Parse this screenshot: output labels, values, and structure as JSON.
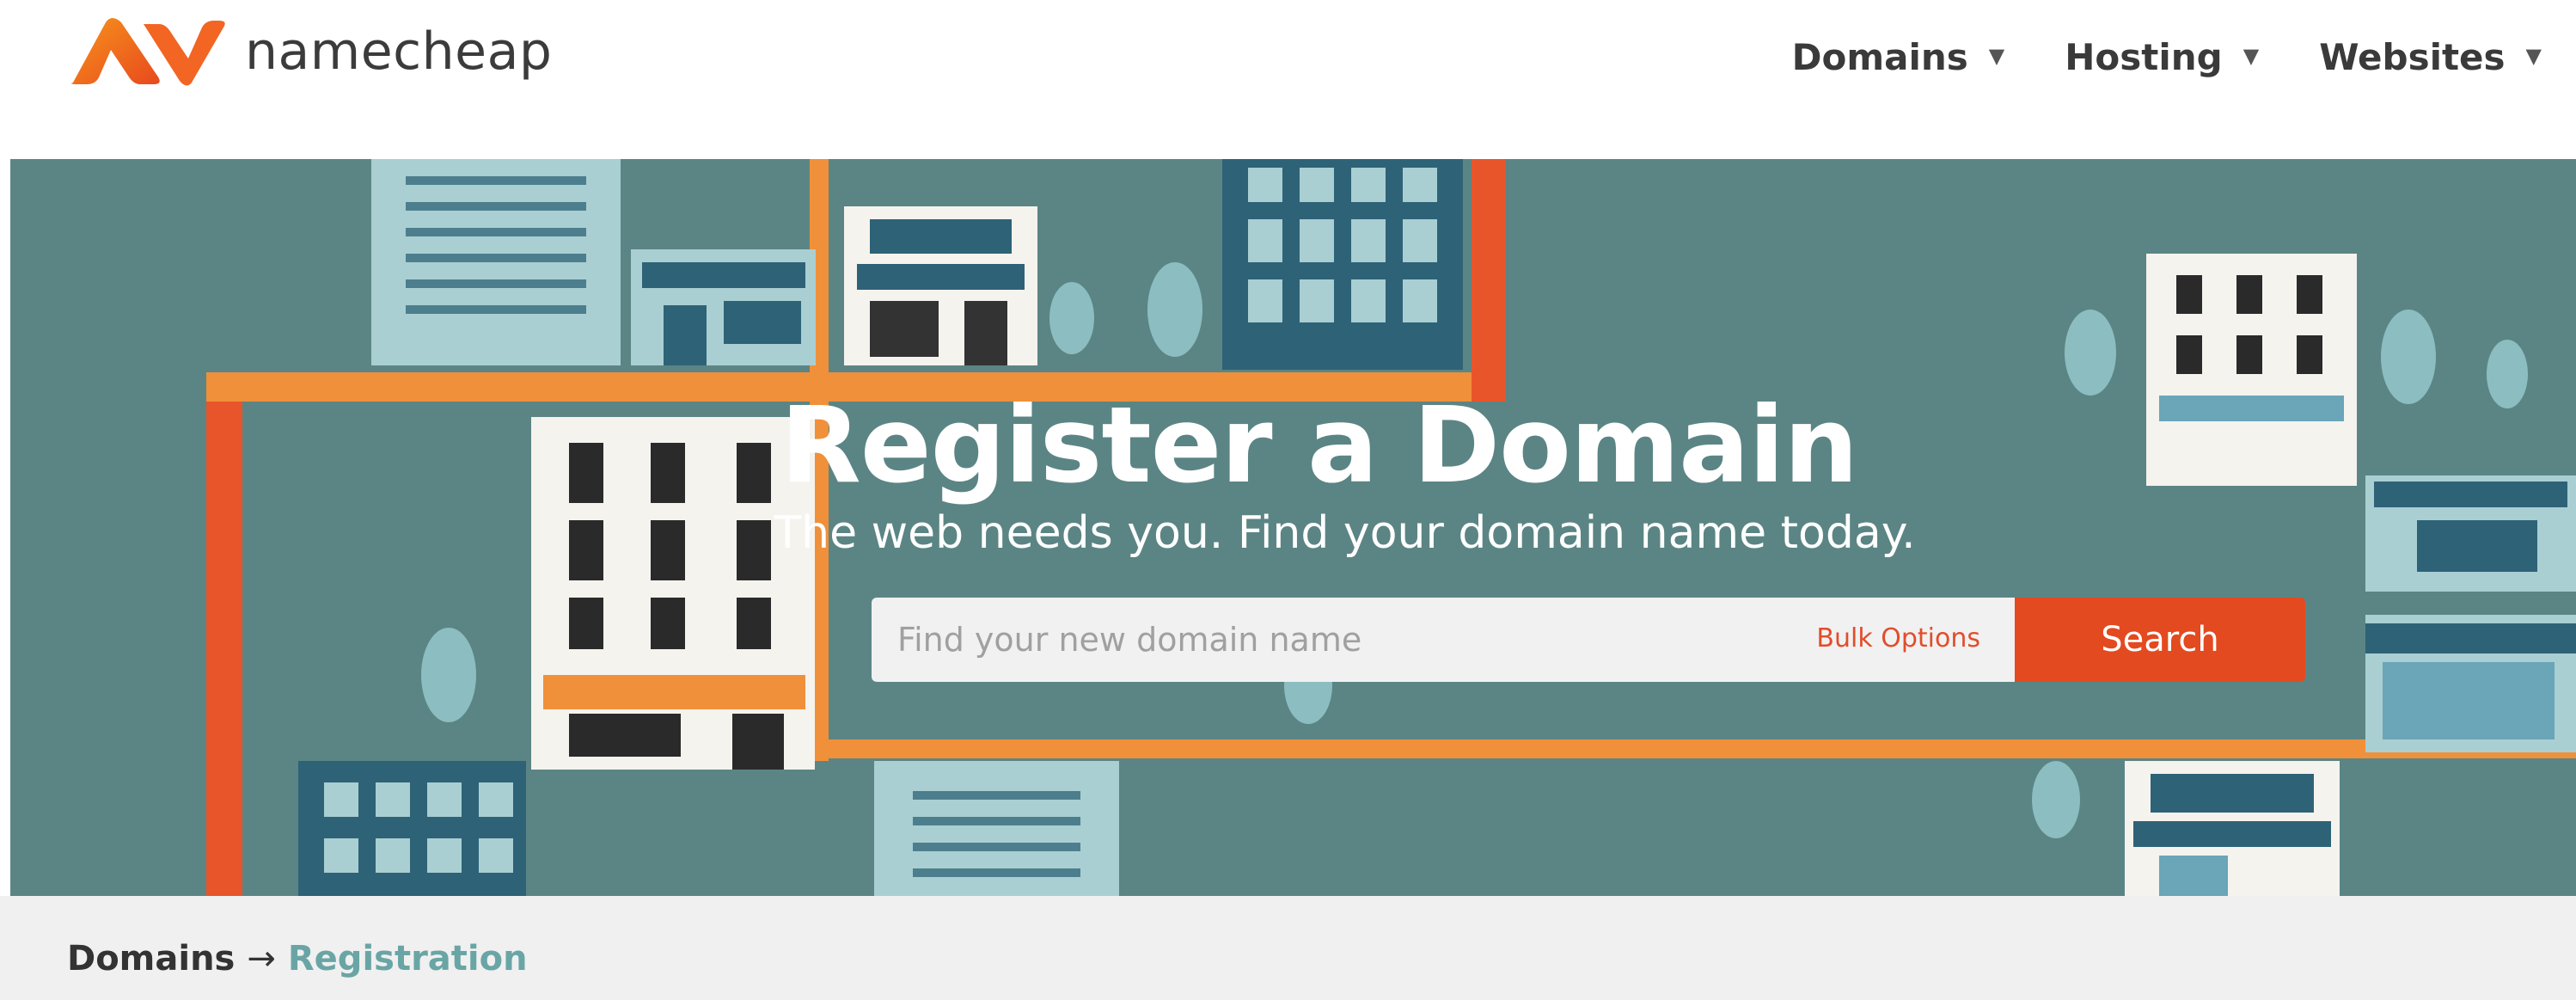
{
  "brand": {
    "name": "namecheap",
    "logo_color": "#f26522"
  },
  "nav": [
    {
      "label": "Domains"
    },
    {
      "label": "Hosting"
    },
    {
      "label": "Websites"
    }
  ],
  "hero": {
    "title": "Register a Domain",
    "subtitle": "The web needs you. Find your domain name today.",
    "search_placeholder": "Find your new domain name",
    "bulk_label": "Bulk Options",
    "search_label": "Search",
    "background_color": "#5b8584",
    "accent_color": "#e34a20"
  },
  "breadcrumb": {
    "parent": "Domains",
    "separator": "→",
    "current": "Registration"
  }
}
